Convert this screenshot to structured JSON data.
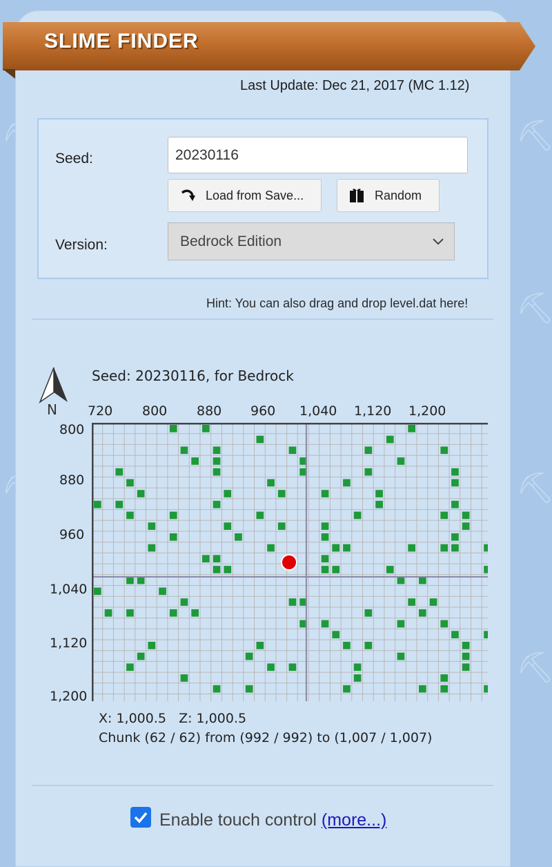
{
  "header": {
    "title": "SLIME FINDER"
  },
  "last_update": "Last Update: Dec 21, 2017 (MC 1.12)",
  "form": {
    "seed_label": "Seed:",
    "seed_value": "20230116",
    "load_button": "Load from Save...",
    "random_button": "Random",
    "version_label": "Version:",
    "version_value": "Bedrock Edition"
  },
  "hint": "Hint: You can also drag and drop level.dat here!",
  "map": {
    "title": "Seed: 20230116, for Bedrock",
    "compass_label": "N",
    "x_ticks": [
      "720",
      "800",
      "880",
      "960",
      "1,040",
      "1,120",
      "1,200"
    ],
    "z_ticks": [
      "800",
      "880",
      "960",
      "1,040",
      "1,120",
      "1,200"
    ],
    "status_xz": "X: 1,000.5   Z: 1,000.5",
    "status_chunk": "Chunk (62 / 62) from (992 / 992) to (1,007 / 1,007)",
    "colors": {
      "slime_chunk": "#1e9a3a",
      "grid_line": "#b8b8b8",
      "marker": "#e00000",
      "crosshair": "#8a8aa8"
    }
  },
  "touch": {
    "label": "Enable touch control",
    "link": "(more...)",
    "checked": true
  }
}
